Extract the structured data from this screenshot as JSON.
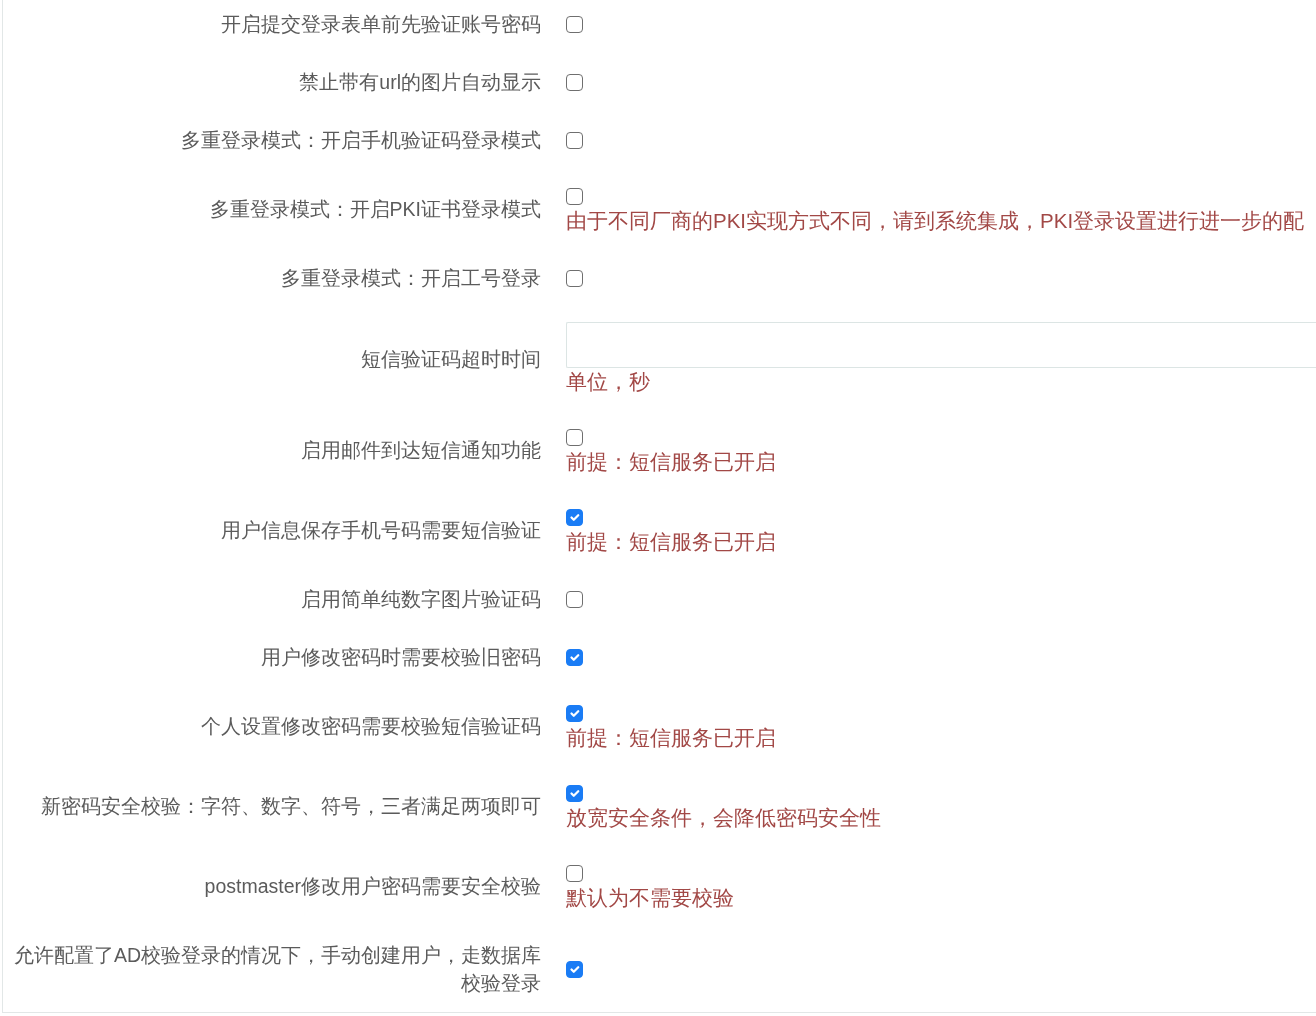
{
  "settings": [
    {
      "kind": "checkbox",
      "label": "开启提交登录表单前先验证账号密码",
      "checked": false
    },
    {
      "kind": "checkbox",
      "label": "禁止带有url的图片自动显示",
      "checked": false
    },
    {
      "kind": "checkbox",
      "label": "多重登录模式：开启手机验证码登录模式",
      "checked": false
    },
    {
      "kind": "checkbox",
      "label": "多重登录模式：开启PKI证书登录模式",
      "checked": false,
      "help": "由于不同厂商的PKI实现方式不同，请到系统集成，PKI登录设置进行进一步的配"
    },
    {
      "kind": "checkbox",
      "label": "多重登录模式：开启工号登录",
      "checked": false
    },
    {
      "kind": "text_input",
      "label": "短信验证码超时时间",
      "help": "单位，秒"
    },
    {
      "kind": "checkbox",
      "label": "启用邮件到达短信通知功能",
      "checked": false,
      "help": "前提：短信服务已开启"
    },
    {
      "kind": "checkbox",
      "label": "用户信息保存手机号码需要短信验证",
      "checked": true,
      "help": "前提：短信服务已开启"
    },
    {
      "kind": "checkbox",
      "label": "启用简单纯数字图片验证码",
      "checked": false
    },
    {
      "kind": "checkbox",
      "label": "用户修改密码时需要校验旧密码",
      "checked": true
    },
    {
      "kind": "checkbox",
      "label": "个人设置修改密码需要校验短信验证码",
      "checked": true,
      "help": "前提：短信服务已开启"
    },
    {
      "kind": "checkbox",
      "label": "新密码安全校验：字符、数字、符号，三者满足两项即可",
      "checked": true,
      "help": "放宽安全条件，会降低密码安全性"
    },
    {
      "kind": "checkbox",
      "label": "postmaster修改用户密码需要安全校验",
      "checked": false,
      "help": "默认为不需要校验"
    },
    {
      "kind": "checkbox",
      "label": "允许配置了AD校验登录的情况下，手动创建用户，走数据库校验登录",
      "checked": true
    }
  ]
}
